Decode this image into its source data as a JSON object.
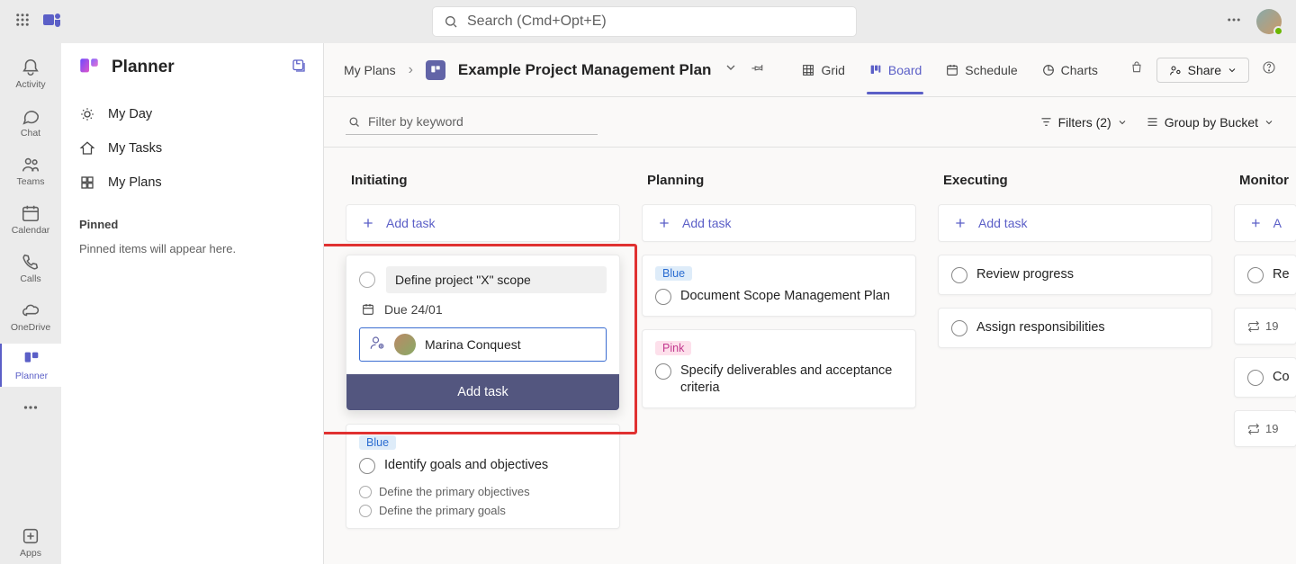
{
  "search_placeholder": "Search (Cmd+Opt+E)",
  "leftrail": [
    "Activity",
    "Chat",
    "Teams",
    "Calendar",
    "Calls",
    "OneDrive",
    "Planner",
    "",
    "Apps"
  ],
  "sidebar": {
    "app_name": "Planner",
    "items": [
      "My Day",
      "My Tasks",
      "My Plans"
    ],
    "section_label": "Pinned",
    "hint": "Pinned items will appear here."
  },
  "header": {
    "breadcrumb": "My Plans",
    "plan_title": "Example Project Management Plan",
    "views": [
      "Grid",
      "Board",
      "Schedule",
      "Charts"
    ],
    "active_view": "Board",
    "share": "Share"
  },
  "toolbar": {
    "filter_placeholder": "Filter by keyword",
    "filters_label": "Filters (2)",
    "groupby_label": "Group by Bucket"
  },
  "board": {
    "add_task_label": "Add task",
    "columns": [
      {
        "name": "Initiating",
        "newtask": {
          "title": "Define project \"X\" scope",
          "due": "Due 24/01",
          "assignee": "Marina Conquest",
          "confirm": "Add task"
        },
        "cards": [
          {
            "badge": {
              "text": "Blue",
              "cls": "blue"
            },
            "title": "Identify goals and objectives",
            "subs": [
              "Define the primary objectives",
              "Define the primary goals"
            ]
          }
        ]
      },
      {
        "name": "Planning",
        "cards": [
          {
            "badge": {
              "text": "Blue",
              "cls": "blue"
            },
            "title": "Document Scope Management Plan"
          },
          {
            "badge": {
              "text": "Pink",
              "cls": "pink"
            },
            "title": "Specify deliverables and acceptance criteria"
          }
        ]
      },
      {
        "name": "Executing",
        "cards": [
          {
            "title": "Review progress"
          },
          {
            "title": "Assign responsibilities"
          }
        ]
      },
      {
        "name": "Monitor",
        "partial_items": [
          "A",
          "Re",
          "19",
          "Co",
          "19"
        ]
      }
    ]
  }
}
